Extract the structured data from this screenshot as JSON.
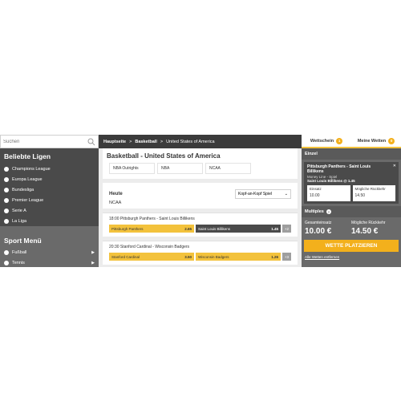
{
  "search": {
    "placeholder": "Suchen"
  },
  "sidebar": {
    "popular_title": "Beliebte Ligen",
    "leagues": [
      {
        "label": "Champions League"
      },
      {
        "label": "Europa League"
      },
      {
        "label": "Bundesliga"
      },
      {
        "label": "Premier League"
      },
      {
        "label": "Serie A"
      },
      {
        "label": "La Liga"
      }
    ],
    "sport_menu_title": "Sport Menü",
    "sports": [
      {
        "label": "Fußball"
      },
      {
        "label": "Tennis"
      }
    ]
  },
  "breadcrumb": {
    "home": "Hauptseite",
    "sep": ">",
    "sport": "Basketball",
    "region": "United States of America"
  },
  "main": {
    "title": "Basketball - United States of America",
    "tabs": [
      {
        "label": "NBA Outrights"
      },
      {
        "label": "NBA"
      },
      {
        "label": "NCAA"
      }
    ],
    "day_label": "Heute",
    "market_select": "Kopf-an-Kopf Spiel",
    "league_label": "NCAA",
    "matches": [
      {
        "title": "18:00 Pittsburgh Panthers - Saint Louis Billikens",
        "home_team": "Pittsburgh Panthers",
        "home_odds": "2.65",
        "away_team": "Saint Louis Billikens",
        "away_odds": "1.45",
        "more": "+2"
      },
      {
        "title": "20:30 Stanford Cardinal - Wisconsin Badgers",
        "home_team": "Stanford Cardinal",
        "home_odds": "3.50",
        "away_team": "Wisconsin Badgers",
        "away_odds": "1.26",
        "more": "+3"
      }
    ]
  },
  "betslip": {
    "tab_slip": "Wettschein",
    "tab_slip_count": "1",
    "tab_mybets": "Meine Wetten",
    "tab_mybets_count": "0",
    "single_header": "Einzel",
    "bet": {
      "name": "Pittsburgh Panthers - Saint Louis Billikens",
      "market": "Money Line - Spiel",
      "pick": "Saint Louis Billikens @ 1.45",
      "stake_label": "Einsatz",
      "stake_value": "10.00",
      "return_label": "Mögliche Rückkehr",
      "return_value": "14.50"
    },
    "multiples_label": "Multiples",
    "total_stake_label": "Gesamteinsatz",
    "total_stake_value": "10.00 €",
    "possible_return_label": "Mögliche Rückkehr",
    "possible_return_value": "14.50 €",
    "place_button": "WETTE PLATZIEREN",
    "remove_all": "Alle Wetten entfernen"
  },
  "colors": {
    "accent": "#f3b01c",
    "odds_bg": "#f3c23c",
    "dark": "#4a4a4a"
  }
}
